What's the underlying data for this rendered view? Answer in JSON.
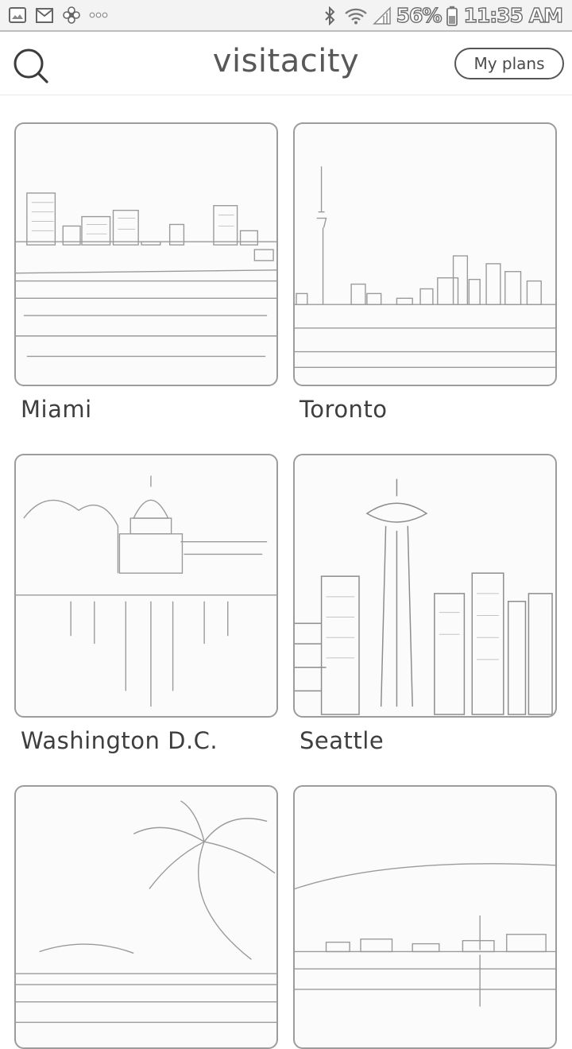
{
  "status_bar": {
    "left_icons": [
      "image-icon",
      "gmail-icon",
      "flower-icon",
      "more-dots-icon"
    ],
    "right_icons": [
      "bluetooth-icon",
      "wifi-icon",
      "signal-icon",
      "battery-icon"
    ],
    "battery": "56%",
    "time": "11:35 AM"
  },
  "header": {
    "brand": "visitacity",
    "my_plans_label": "My plans"
  },
  "cities": [
    {
      "name": "Miami"
    },
    {
      "name": "Toronto"
    },
    {
      "name": "Washington D.C."
    },
    {
      "name": "Seattle"
    },
    {
      "name": ""
    },
    {
      "name": ""
    }
  ]
}
